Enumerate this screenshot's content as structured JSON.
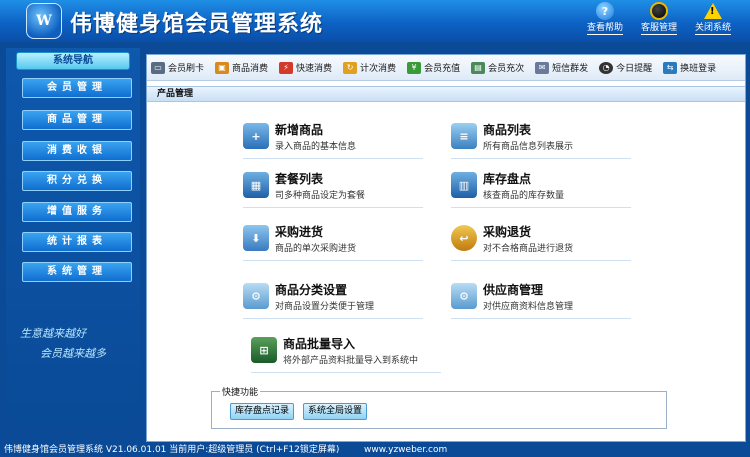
{
  "app": {
    "title": "伟博健身馆会员管理系统",
    "logo_text": "W"
  },
  "top_tools": [
    {
      "label": "查看帮助",
      "icon": "help-icon"
    },
    {
      "label": "客服管理",
      "icon": "qq-penguin-icon"
    },
    {
      "label": "关闭系统",
      "icon": "warning-icon"
    }
  ],
  "sidebar": {
    "header": "系统导航",
    "items": [
      {
        "label": "会员管理"
      },
      {
        "label": "商品管理"
      },
      {
        "label": "消费收银"
      },
      {
        "label": "积分兑换"
      },
      {
        "label": "增值服务"
      },
      {
        "label": "统计报表"
      },
      {
        "label": "系统管理"
      }
    ],
    "slogan": [
      "生意越来越好",
      "会员越来越多"
    ]
  },
  "toolbar": [
    {
      "label": "会员刷卡",
      "icon": "card-reader-icon",
      "color": "#5a6c84"
    },
    {
      "label": "商品消费",
      "icon": "shopping-icon",
      "color": "#d98a1c"
    },
    {
      "label": "快速消费",
      "icon": "fast-consume-icon",
      "color": "#d23a2a"
    },
    {
      "label": "计次消费",
      "icon": "count-consume-icon",
      "color": "#e0a020"
    },
    {
      "label": "会员充值",
      "icon": "recharge-icon",
      "color": "#3a9a3a"
    },
    {
      "label": "会员充次",
      "icon": "recharge-times-icon",
      "color": "#4a8a5a"
    },
    {
      "label": "短信群发",
      "icon": "sms-icon",
      "color": "#6a7a9a"
    },
    {
      "label": "今日提醒",
      "icon": "reminder-icon",
      "color": "#333333"
    },
    {
      "label": "换班登录",
      "icon": "shift-login-icon",
      "color": "#2a7ac0"
    }
  ],
  "section_title": "产品管理",
  "features": [
    {
      "title": "新增商品",
      "desc": "录入商品的基本信息",
      "icon": "add-product-icon"
    },
    {
      "title": "商品列表",
      "desc": "所有商品信息列表展示",
      "icon": "product-list-icon"
    },
    {
      "title": "套餐列表",
      "desc": "司多种商品设定为套餐",
      "icon": "package-list-icon"
    },
    {
      "title": "库存盘点",
      "desc": "核查商品的库存数量",
      "icon": "inventory-icon"
    },
    {
      "title": "采购进货",
      "desc": "商品的单次采购进货",
      "icon": "purchase-icon"
    },
    {
      "title": "采购退货",
      "desc": "对不合格商品进行退货",
      "icon": "purchase-return-icon"
    },
    {
      "title": "商品分类设置",
      "desc": "对商品设置分类便于管理",
      "icon": "category-settings-icon"
    },
    {
      "title": "供应商管理",
      "desc": "对供应商资料信息管理",
      "icon": "supplier-icon"
    },
    {
      "title": "商品批量导入",
      "desc": "将外部产品资料批量导入到系统中",
      "icon": "batch-import-icon"
    }
  ],
  "quick": {
    "legend": "快捷功能",
    "buttons": [
      {
        "label": "库存盘点记录"
      },
      {
        "label": "系统全局设置"
      }
    ]
  },
  "status": {
    "text": "伟博健身馆会员管理系统 V21.06.01.01  当前用户:超级管理员 (Ctrl+F12锁定屏幕)",
    "url": "www.yzweber.com"
  }
}
